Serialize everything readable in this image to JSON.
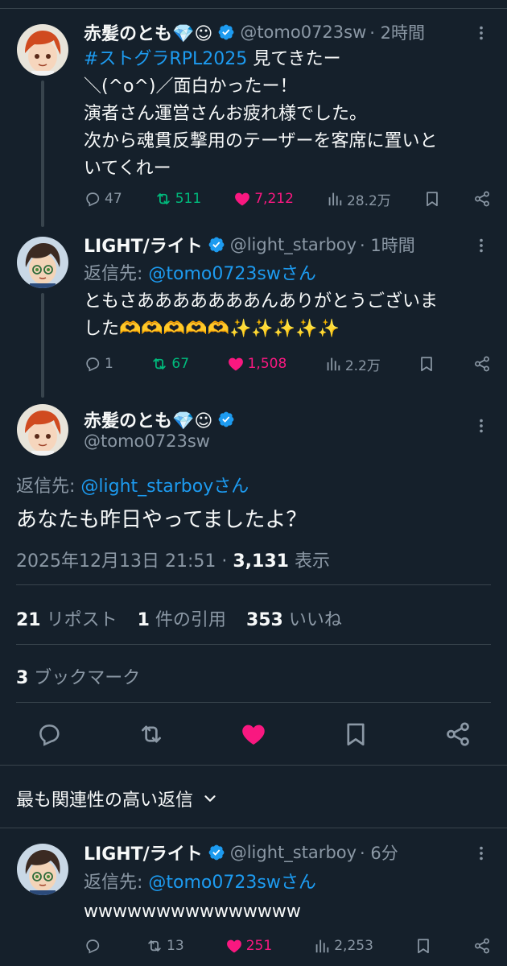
{
  "colors": {
    "background": "#15202b",
    "text": "#f7f9f9",
    "secondary": "#8b98a5",
    "link": "#1d9bf0",
    "retweet": "#00ba7c",
    "like": "#f91880",
    "border": "#38444d"
  },
  "tweet1": {
    "name": "赤髪のとも💎☺",
    "handle": "@tomo0723sw",
    "time": "· 2時間",
    "hashtag": "#ストグラRPL2025",
    "text_rest": " 見てきたー\n＼(^o^)／面白かったー！\n演者さん運営さんお疲れ様でした。\n次から魂貫反撃用のテーザーを客席に置いと\nいてくれー",
    "replies": "47",
    "retweets": "511",
    "likes": "7,212",
    "views": "28.2万"
  },
  "tweet2": {
    "name": "LIGHT/ライト",
    "handle": "@light_starboy",
    "time": "· 1時間",
    "reply_prefix": "返信先: ",
    "reply_to": "@tomo0723swさん",
    "text": "ともさあああああああんありがとうございま\nした🫶🫶🫶🫶🫶✨✨✨✨✨",
    "replies": "1",
    "retweets": "67",
    "likes": "1,508",
    "views": "2.2万"
  },
  "main": {
    "name": "赤髪のとも💎☺",
    "handle": "@tomo0723sw",
    "reply_prefix": "返信先: ",
    "reply_to": "@light_starboyさん",
    "text": "あなたも昨日やってましたよ？",
    "datetime": "2025年12月13日 21:51 · ",
    "view_count": "3,131",
    "view_label": " 表示",
    "reposts_count": "21",
    "reposts_label": " リポスト",
    "quotes_count": "1",
    "quotes_label": " 件の引用",
    "likes_count": "353",
    "likes_label": " いいね",
    "bookmarks_count": "3",
    "bookmarks_label": " ブックマーク"
  },
  "sort": {
    "label": "最も関連性の高い返信"
  },
  "reply3": {
    "name": "LIGHT/ライト",
    "handle": "@light_starboy",
    "time": "· 6分",
    "reply_prefix": "返信先: ",
    "reply_to": "@tomo0723swさん",
    "text": "wwwwwwwwwwwwwww",
    "replies": "",
    "retweets": "13",
    "likes": "251",
    "views": "2,253"
  }
}
